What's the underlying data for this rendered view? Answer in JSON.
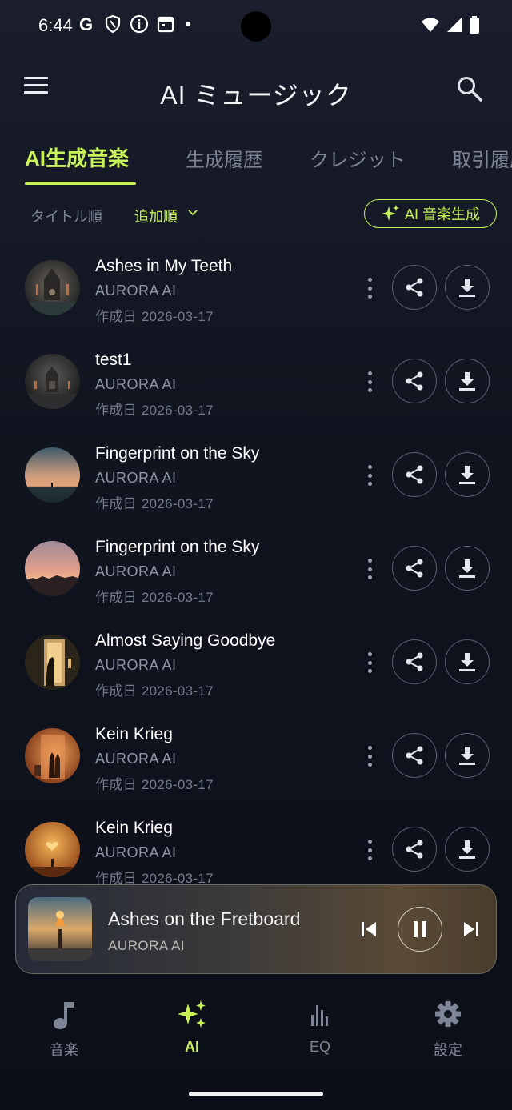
{
  "status_bar": {
    "time": "6:44",
    "left_icons": [
      "google-icon",
      "shield-icon",
      "info-icon",
      "calendar-icon",
      "dot-icon"
    ],
    "right_icons": [
      "wifi-icon",
      "signal-icon",
      "battery-icon"
    ]
  },
  "app_bar": {
    "title": "AI ミュージック",
    "menu_icon": "menu-icon",
    "search_icon": "search-icon"
  },
  "tabs": [
    {
      "label": "AI生成音楽",
      "active": true
    },
    {
      "label": "生成履歴",
      "active": false
    },
    {
      "label": "クレジット",
      "active": false
    },
    {
      "label": "取引履歴",
      "active": false
    }
  ],
  "filters": {
    "sort_title": "タイトル順",
    "sort_added": "追加順",
    "generate_button": "AI 音楽生成"
  },
  "date_label": "作成日",
  "tracks": [
    {
      "title": "Ashes in My Teeth",
      "artist": "AURORA AI",
      "date": "2026-03-17"
    },
    {
      "title": "test1",
      "artist": "AURORA AI",
      "date": "2026-03-17"
    },
    {
      "title": "Fingerprint on the Sky",
      "artist": "AURORA AI",
      "date": "2026-03-17"
    },
    {
      "title": "Fingerprint on the Sky",
      "artist": "AURORA AI",
      "date": "2026-03-17"
    },
    {
      "title": "Almost Saying Goodbye",
      "artist": "AURORA AI",
      "date": "2026-03-17"
    },
    {
      "title": "Kein Krieg",
      "artist": "AURORA AI",
      "date": "2026-03-17"
    },
    {
      "title": "Kein Krieg",
      "artist": "AURORA AI",
      "date": "2026-03-17"
    }
  ],
  "now_playing": {
    "title": "Ashes on the Fretboard",
    "artist": "AURORA AI"
  },
  "bottom_nav": [
    {
      "label": "音楽",
      "icon": "music-note-icon",
      "active": false
    },
    {
      "label": "AI",
      "icon": "sparkles-icon",
      "active": true
    },
    {
      "label": "EQ",
      "icon": "equalizer-icon",
      "active": false
    },
    {
      "label": "設定",
      "icon": "gear-icon",
      "active": false
    }
  ],
  "colors": {
    "accent": "#c7f25a",
    "background": "#10141f",
    "muted_text": "#7e8596"
  }
}
